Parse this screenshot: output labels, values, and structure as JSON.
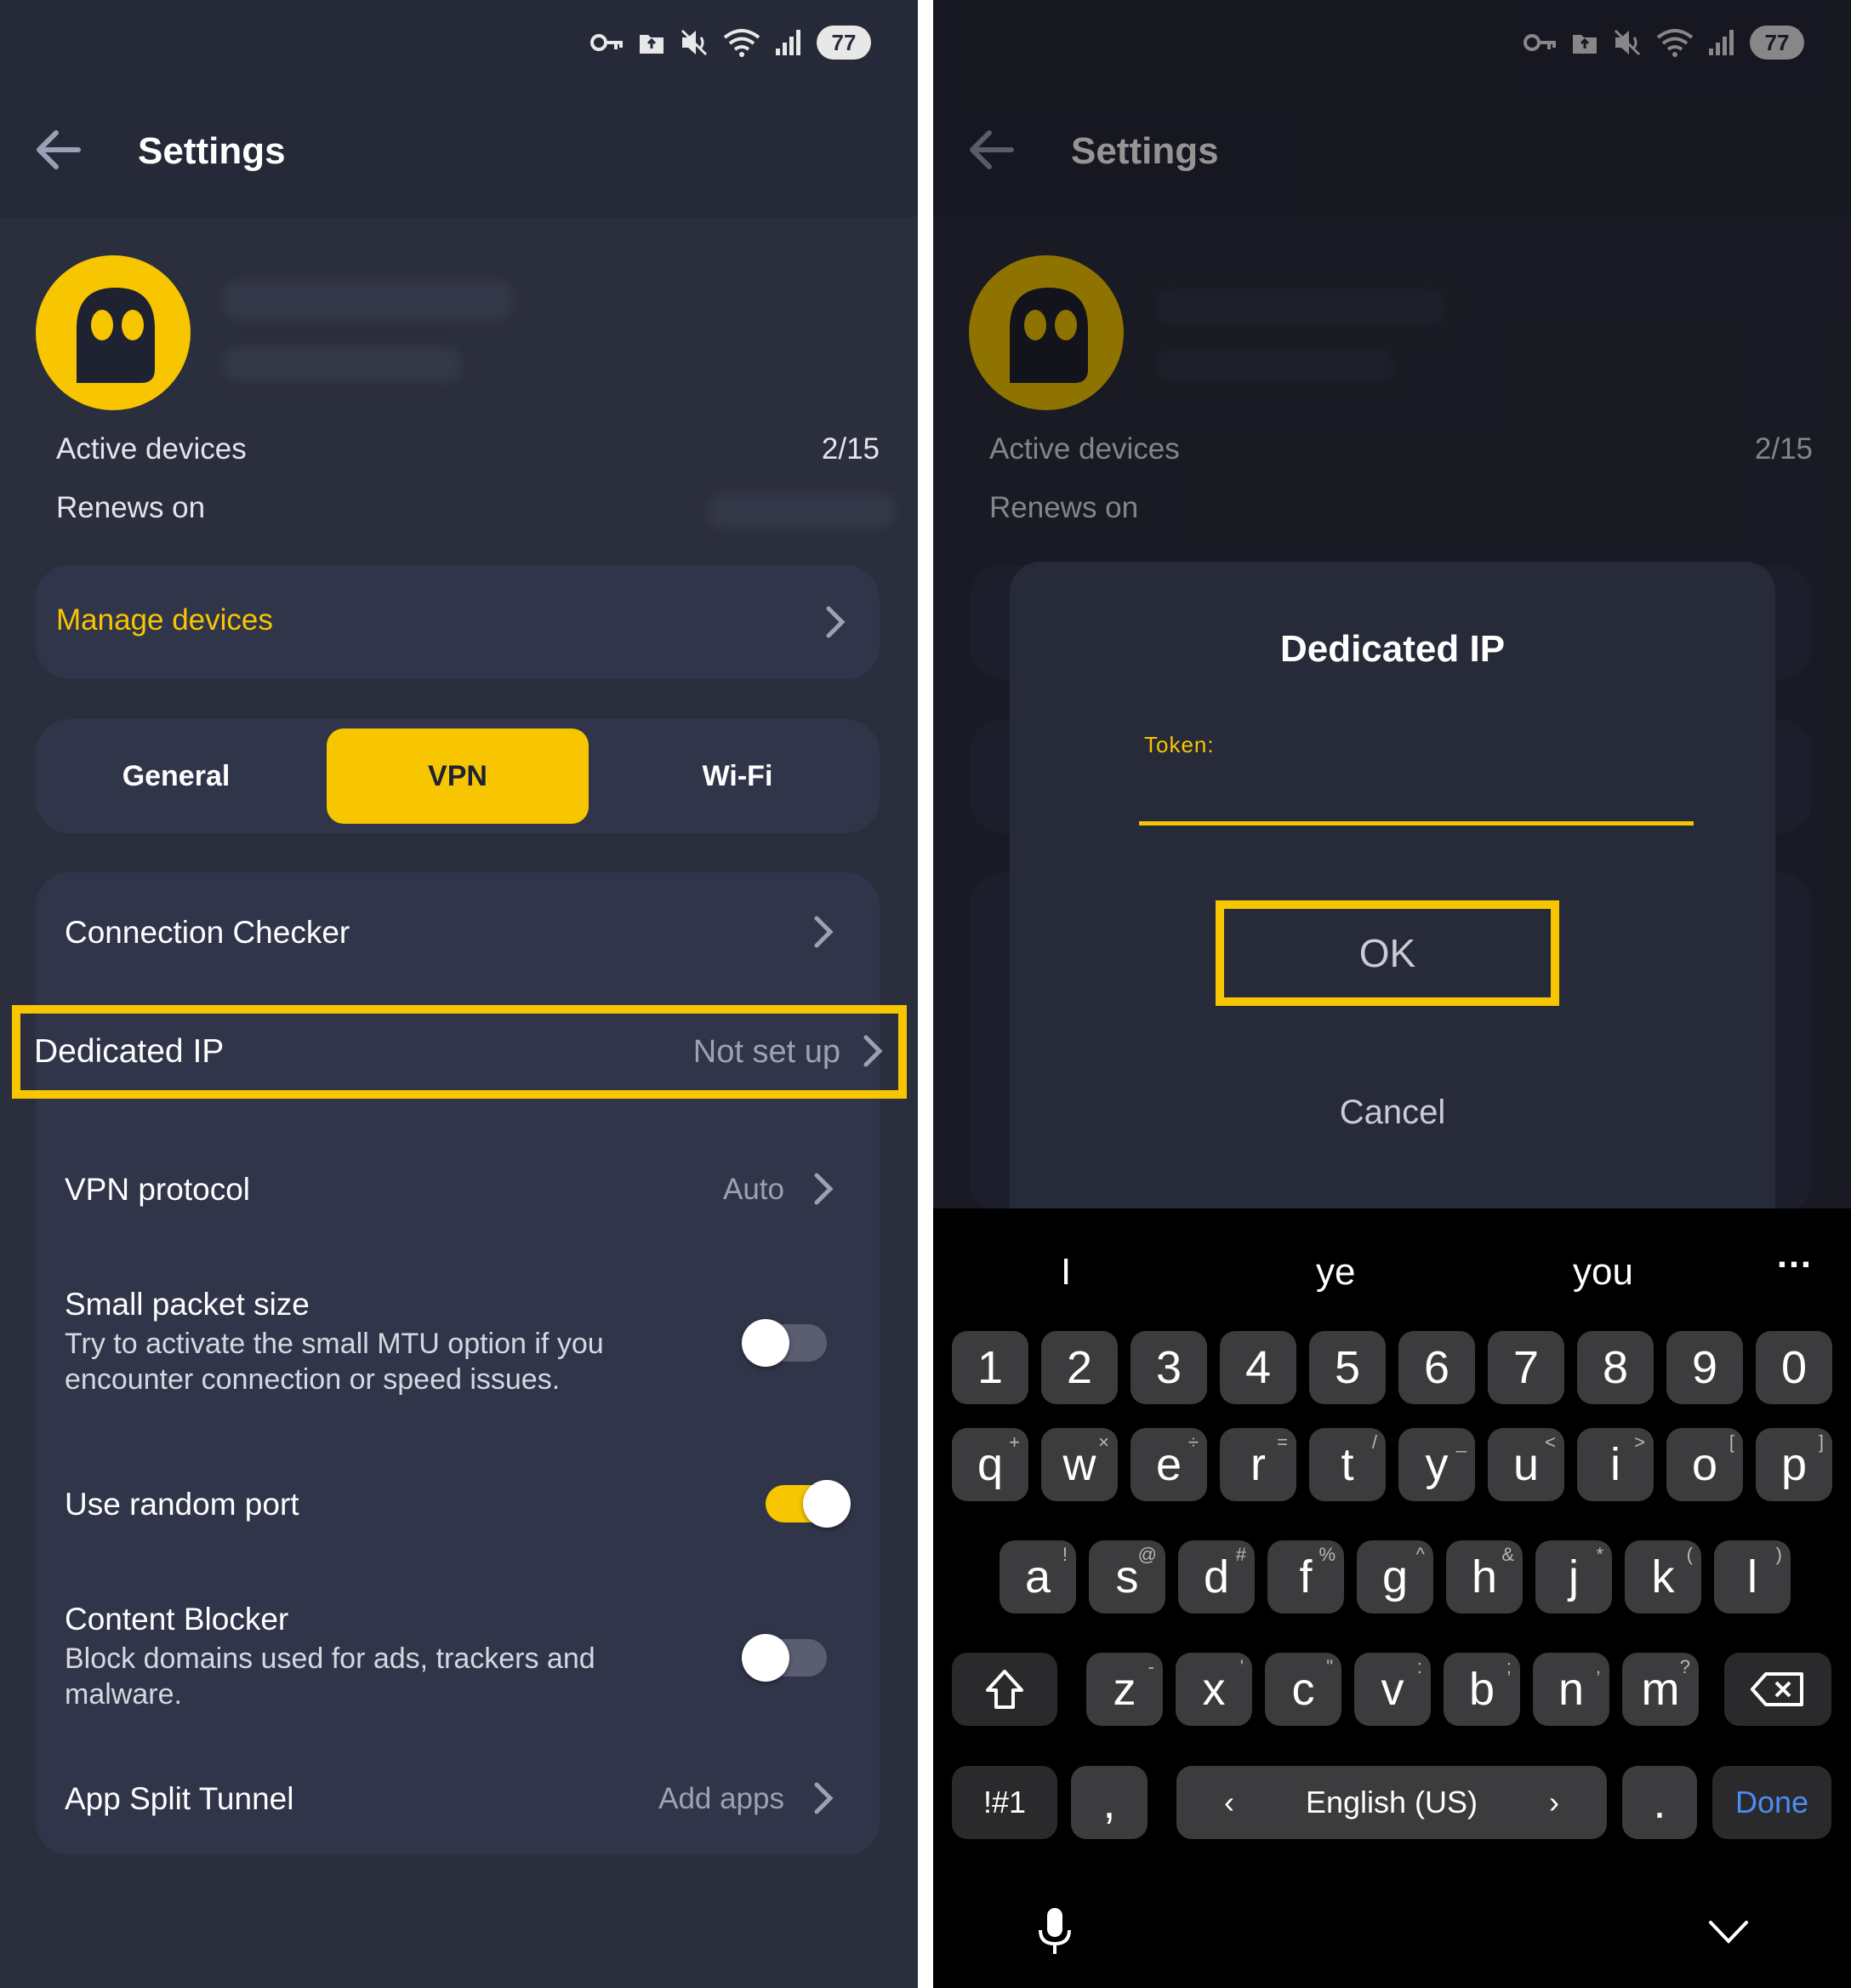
{
  "status_bar": {
    "battery": "77"
  },
  "left": {
    "title": "Settings",
    "account": {
      "active_devices_label": "Active devices",
      "active_devices_value": "2/15",
      "renews_on_label": "Renews on"
    },
    "manage_devices": "Manage devices",
    "tabs": [
      {
        "label": "General"
      },
      {
        "label": "VPN"
      },
      {
        "label": "Wi-Fi"
      }
    ],
    "settings": {
      "connection_checker": "Connection Checker",
      "dedicated_ip": {
        "label": "Dedicated IP",
        "value": "Not set up"
      },
      "vpn_protocol": {
        "label": "VPN protocol",
        "value": "Auto"
      },
      "small_packet": {
        "label": "Small packet size",
        "desc_line1": "Try to activate the small MTU option if you",
        "desc_line2": "encounter connection or speed issues."
      },
      "random_port": {
        "label": "Use random port"
      },
      "content_blocker": {
        "label": "Content Blocker",
        "desc_line1": "Block domains used for ads, trackers and",
        "desc_line2": "malware."
      },
      "split_tunnel": {
        "label": "App Split Tunnel",
        "value": "Add apps"
      }
    }
  },
  "right": {
    "title": "Settings",
    "active_devices_label": "Active devices",
    "active_devices_value": "2/15",
    "renews_on_label": "Renews on",
    "dialog": {
      "title": "Dedicated IP",
      "token_label": "Token:",
      "ok": "OK",
      "cancel": "Cancel"
    },
    "keyboard": {
      "suggestions": [
        "I",
        "ye",
        "you"
      ],
      "more": "…",
      "number_row": [
        "1",
        "2",
        "3",
        "4",
        "5",
        "6",
        "7",
        "8",
        "9",
        "0"
      ],
      "row1": [
        "q",
        "w",
        "e",
        "r",
        "t",
        "y",
        "u",
        "i",
        "o",
        "p"
      ],
      "row1_sup": [
        "+",
        "×",
        "÷",
        "=",
        "/",
        "_",
        "<",
        ">",
        "[",
        "]"
      ],
      "row2": [
        "a",
        "s",
        "d",
        "f",
        "g",
        "h",
        "j",
        "k",
        "l"
      ],
      "row2_sup": [
        "!",
        "@",
        "#",
        "%",
        "^",
        "&",
        "*",
        "(",
        ")"
      ],
      "row3": [
        "z",
        "x",
        "c",
        "v",
        "b",
        "n",
        "m"
      ],
      "row3_sup": [
        "-",
        "'",
        "\"",
        ":",
        ";",
        ",",
        "?"
      ],
      "symbols": "!#1",
      "comma": ",",
      "language": "English (US)",
      "period": ".",
      "done": "Done"
    }
  },
  "colors": {
    "accent": "#f7c600",
    "background": "#2b2e3d",
    "card": "#31354a",
    "done_blue": "#4b8cf5"
  }
}
